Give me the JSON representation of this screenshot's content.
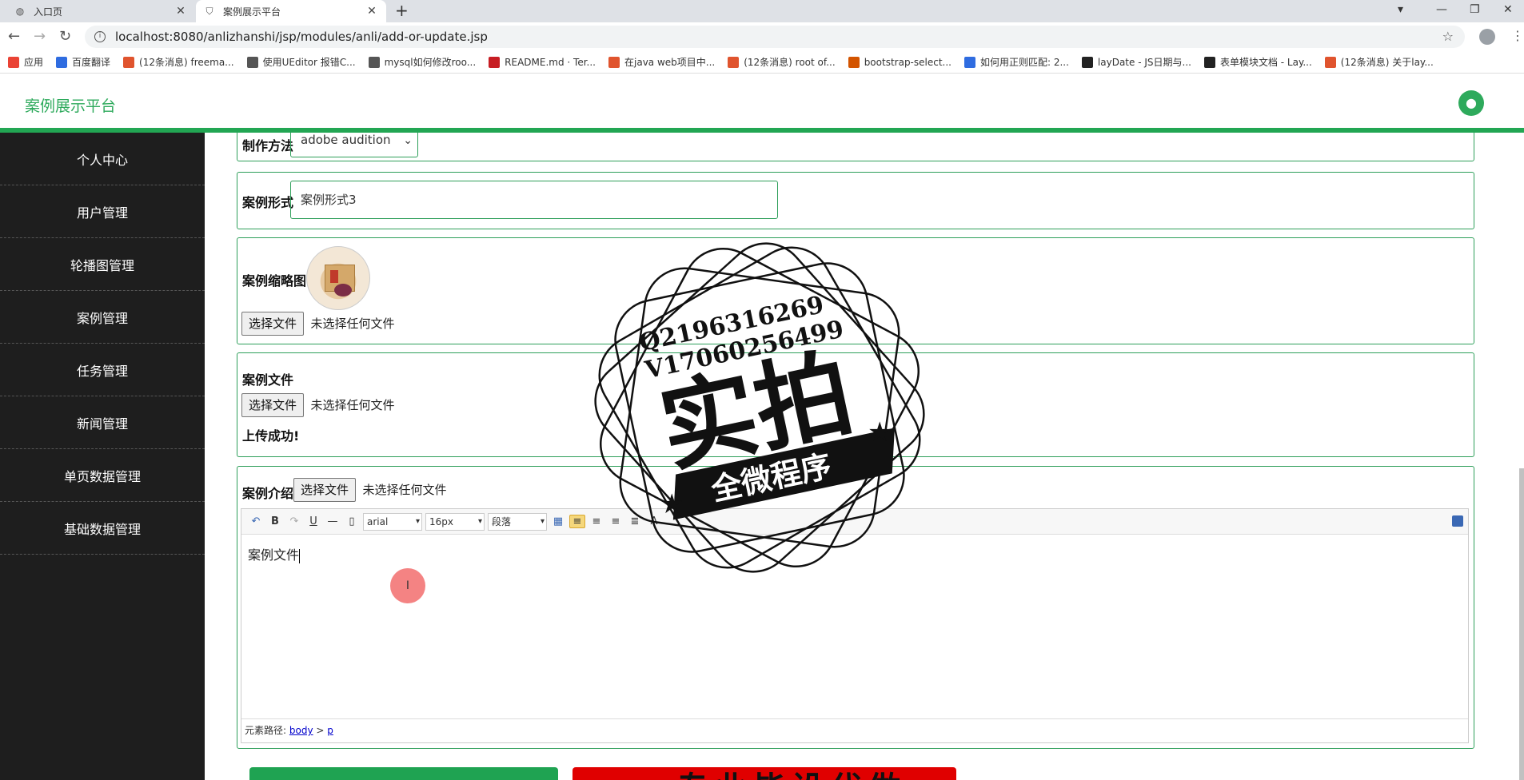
{
  "browser": {
    "tabs": [
      {
        "label": "入口页",
        "icon": "globe-icon"
      },
      {
        "label": "案例展示平台",
        "icon": "shield-icon"
      }
    ],
    "url": "localhost:8080/anlizhanshi/jsp/modules/anli/add-or-update.jsp",
    "bookmarks": [
      {
        "label": "应用",
        "color": "#ea4335"
      },
      {
        "label": "百度翻译",
        "color": "#2f6ce0"
      },
      {
        "label": "(12条消息) freema...",
        "color": "#e0542e"
      },
      {
        "label": "使用UEditor 报错C...",
        "color": "#555555"
      },
      {
        "label": "mysql如何修改roo...",
        "color": "#555555"
      },
      {
        "label": "README.md · Ter...",
        "color": "#c71d23"
      },
      {
        "label": "在java web项目中...",
        "color": "#e0542e"
      },
      {
        "label": "(12条消息) root of...",
        "color": "#e0542e"
      },
      {
        "label": "bootstrap-select...",
        "color": "#d35400"
      },
      {
        "label": "如何用正则匹配: 2...",
        "color": "#2f6ce0"
      },
      {
        "label": "layDate - JS日期与...",
        "color": "#222222"
      },
      {
        "label": "表单模块文档 - Lay...",
        "color": "#222222"
      },
      {
        "label": "(12条消息) 关于lay...",
        "color": "#e0542e"
      }
    ]
  },
  "app": {
    "title": "案例展示平台"
  },
  "sidebar": {
    "items": [
      {
        "label": "个人中心"
      },
      {
        "label": "用户管理"
      },
      {
        "label": "轮播图管理"
      },
      {
        "label": "案例管理"
      },
      {
        "label": "任务管理"
      },
      {
        "label": "新闻管理"
      },
      {
        "label": "单页数据管理"
      },
      {
        "label": "基础数据管理"
      }
    ]
  },
  "form": {
    "method": {
      "label": "制作方法",
      "value": "adobe audition"
    },
    "form_type": {
      "label": "案例形式",
      "value": "案例形式3"
    },
    "thumbnail": {
      "label": "案例缩略图",
      "button": "选择文件",
      "file_status": "未选择任何文件"
    },
    "case_file": {
      "label": "案例文件",
      "button": "选择文件",
      "file_status": "未选择任何文件",
      "message": "上传成功!"
    },
    "intro": {
      "label": "案例介绍",
      "button": "选择文件",
      "file_status": "未选择任何文件",
      "toolbar": {
        "font": "arial",
        "size": "16px",
        "paragraph": "段落"
      },
      "content": "案例文件",
      "path_label": "元素路径:",
      "path_body": "body",
      "path_sep": ">",
      "path_p": "p"
    }
  },
  "watermark": {
    "line1": "Q2196316269",
    "line2": "V17060256499",
    "main": "实拍",
    "banner": "全微程序"
  },
  "bottom_banner": {
    "text": "专业毕设代做"
  },
  "colors": {
    "accent": "#22a653",
    "sidebar_bg": "#1e1e1e",
    "border": "#2e9f5a"
  }
}
